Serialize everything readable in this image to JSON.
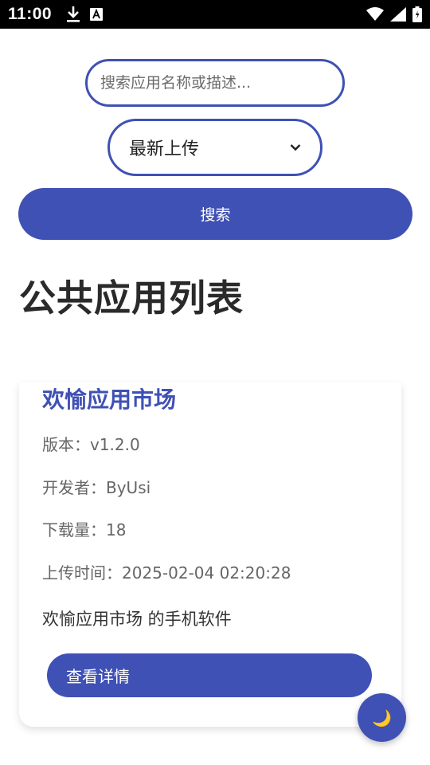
{
  "status_bar": {
    "time": "11:00",
    "icons": [
      "download-icon",
      "font-icon",
      "wifi-icon",
      "signal-icon",
      "battery-icon"
    ]
  },
  "search": {
    "placeholder": "搜索应用名称或描述...",
    "value": ""
  },
  "sort": {
    "selected": "最新上传"
  },
  "search_button": {
    "label": "搜索"
  },
  "page_title": "公共应用列表",
  "apps": [
    {
      "name": "欢愉应用市场",
      "version_label": "版本：",
      "version": "v1.2.0",
      "developer_label": "开发者：",
      "developer": "ByUsi",
      "downloads_label": "下载量：",
      "downloads": "18",
      "upload_time_label": "上传时间：",
      "upload_time": "2025-02-04 02:20:28",
      "description": "欢愉应用市场 的手机软件",
      "detail_button": "查看详情"
    }
  ],
  "theme_toggle": {
    "icon": "moon-icon",
    "glyph": "🌙"
  },
  "colors": {
    "accent": "#3f51b5",
    "status_bar": "#000000",
    "title": "#2a2a2a",
    "meta_text": "#666666"
  }
}
